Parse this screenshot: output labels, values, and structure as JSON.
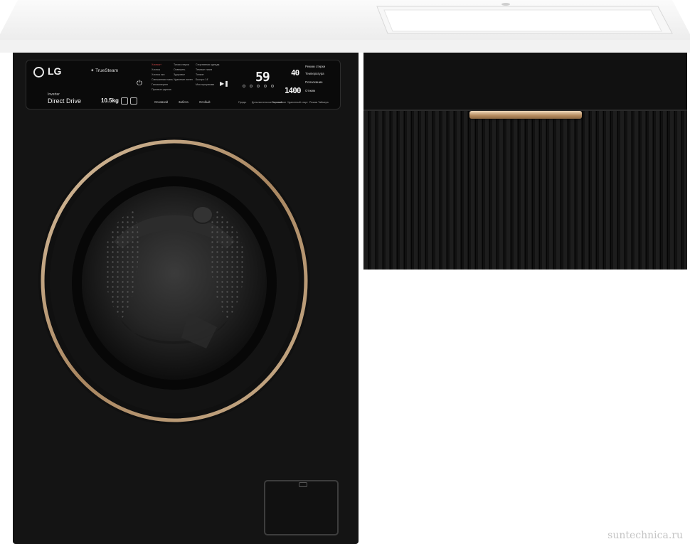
{
  "colors": {
    "washer_body": "#141414",
    "door_ring": "#b89a76",
    "handle": "#c9a57e",
    "countertop": "#f4f4f4",
    "cabinet": "#111111"
  },
  "panel": {
    "brand": "LG",
    "truesteam": "TrueSteam",
    "inverter": "Inverter",
    "direct_drive": "Direct Drive",
    "capacity": "10.5kg",
    "power_icon": "power-icon",
    "start_pause_icon": "play-pause-icon",
    "programs": [
      {
        "label": "Хлопок+",
        "highlight": true
      },
      {
        "label": "Хлопок",
        "highlight": false
      },
      {
        "label": "Хлопок эко",
        "highlight": false
      },
      {
        "label": "Смешанная ткань",
        "highlight": false
      },
      {
        "label": "Гипоаллерген",
        "highlight": false
      },
      {
        "label": "Пуховые одеяла",
        "highlight": false
      },
      {
        "label": "Тихая стирка",
        "highlight": false
      },
      {
        "label": "Освежить",
        "highlight": false
      },
      {
        "label": "Здоровье",
        "highlight": false
      },
      {
        "label": "Удаление пятен",
        "highlight": false
      },
      {
        "label": "Спортивная одежда",
        "highlight": false
      },
      {
        "label": "Темные ткани",
        "highlight": false
      },
      {
        "label": "Тонкие",
        "highlight": false
      },
      {
        "label": "Быстро 14'",
        "highlight": false
      },
      {
        "label": "Моя программа",
        "highlight": false
      }
    ],
    "bottom_labels": [
      "Основной",
      "Забота",
      "Особый"
    ],
    "time_display": "59",
    "temp_display": "40",
    "spin_display": "1400",
    "options": [
      "Режим стирки",
      "Температура",
      "Полоскание",
      "Отжим"
    ],
    "function_buttons": [
      "Предв.",
      "Дополнительное полоскание",
      "Паровой",
      "Удаленный старт",
      "Режим Таймера"
    ]
  },
  "watermark": "suntechnica.ru"
}
